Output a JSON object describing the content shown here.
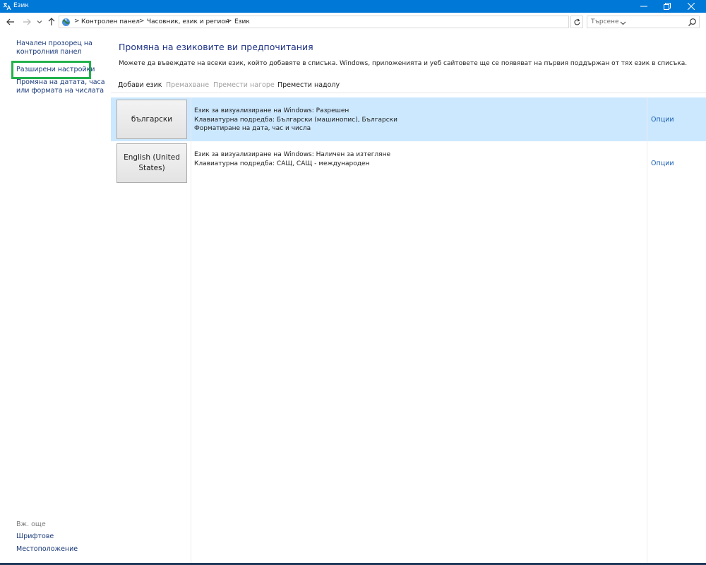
{
  "window": {
    "title": "Език",
    "minimize_icon": "minimize-icon",
    "maximize_icon": "maximize-icon",
    "close_icon": "close-icon"
  },
  "address": {
    "breadcrumb": [
      "Контролен панел",
      "Часовник, език и регион",
      "Език"
    ],
    "separator": ">",
    "search_placeholder": "Търсене"
  },
  "sidebar": {
    "home_link": "Начален прозорец на контролния панел",
    "advanced_link": "Разширени настройки",
    "date_format_link": "Промяна на датата, часа или формата на числата",
    "see_also_label": "Вж. още",
    "fonts_link": "Шрифтове",
    "location_link": "Местоположение"
  },
  "main": {
    "heading": "Промяна на езиковите ви предпочитания",
    "description": "Можете да въвеждате на всеки език, който добавяте в списъка. Windows, приложенията и уеб сайтовете ще се появяват на първия поддържан от тях език в списъка.",
    "toolbar": {
      "add": "Добави език",
      "remove": "Премахване",
      "move_up": "Премести нагоре",
      "move_down": "Премести надолу"
    },
    "languages": [
      {
        "name": "български",
        "details": [
          "Език за визуализиране на Windows:  Разрешен",
          "Клавиатурна подредба: Български (машинопис), Български",
          "Форматиране на дата, час и числа"
        ],
        "options": "Опции",
        "selected": true
      },
      {
        "name": "English (United States)",
        "details": [
          "Език за визуализиране на Windows:  Наличен за изтегляне",
          "Клавиатурна подредба: САЩ, САЩ - международен"
        ],
        "options": "Опции",
        "selected": false
      }
    ]
  },
  "colors": {
    "titlebar": "#0078d7",
    "selected_row": "#cce8ff",
    "highlight_box": "#22b14c",
    "heading": "#1e3287",
    "link": "#1a5fb4"
  }
}
